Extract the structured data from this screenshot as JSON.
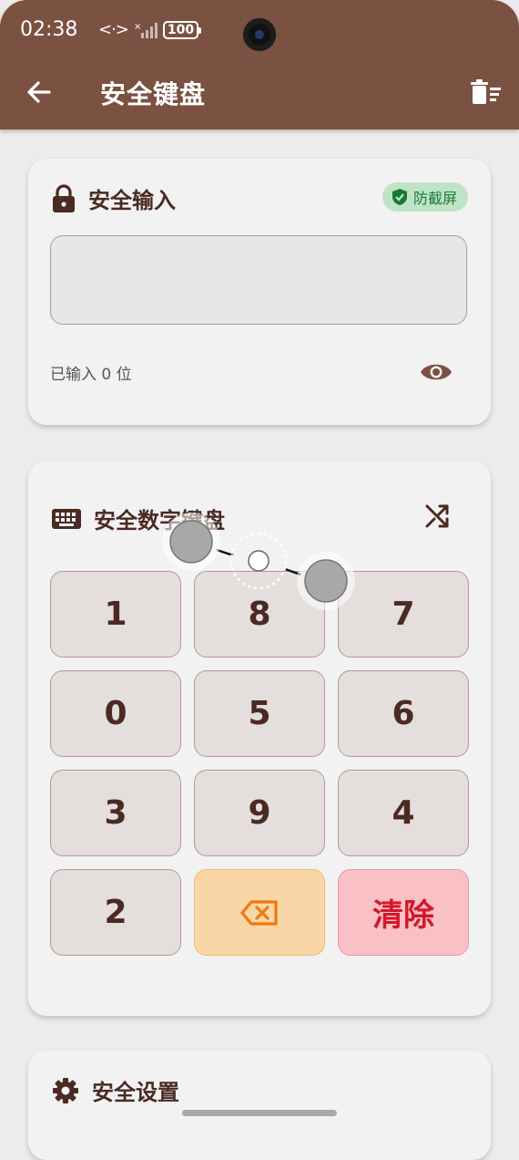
{
  "status_bar": {
    "time": "02:38",
    "network": "<·>",
    "battery": "100"
  },
  "app_bar": {
    "title": "安全键盘",
    "back_icon": "arrow-left-icon",
    "action_icon": "clear-list-icon"
  },
  "secure_input_card": {
    "title": "安全输入",
    "icon": "lock-icon",
    "badge": {
      "label": "防截屏",
      "icon": "shield-check-icon",
      "color": "#1a7a33"
    },
    "input_value": "",
    "count_label": "已输入 0 位",
    "visibility_icon": "eye-icon"
  },
  "keyboard_card": {
    "title": "安全数字键盘",
    "icon": "keyboard-icon",
    "shuffle_icon": "shuffle-icon",
    "keys": [
      "1",
      "8",
      "7",
      "0",
      "5",
      "6",
      "3",
      "9",
      "4",
      "2"
    ],
    "backspace_icon": "backspace-icon",
    "clear_label": "清除"
  },
  "settings_card": {
    "title": "安全设置",
    "icon": "gear-icon"
  },
  "colors": {
    "app_bar": "#7b5142",
    "key_bg": "#e4dedd",
    "backspace_bg": "#f8d6a6",
    "clear_bg": "#f9c0c5",
    "clear_text": "#d3172a",
    "badge_bg": "#bfe3c7"
  }
}
